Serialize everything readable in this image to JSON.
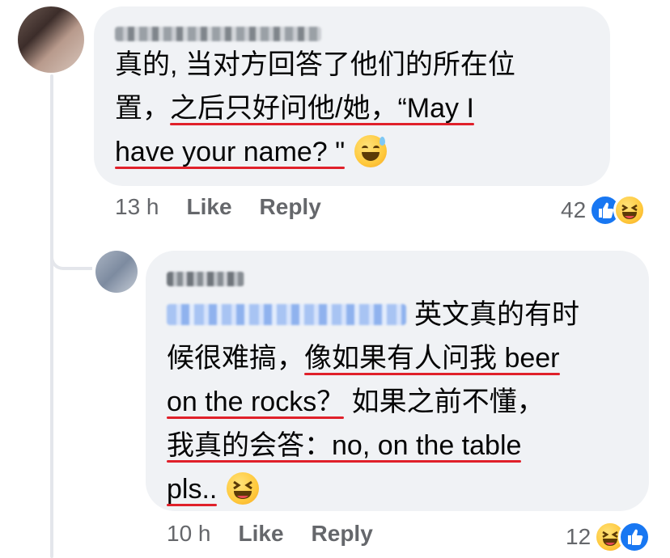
{
  "comment1": {
    "text_lines": [
      "真的, 当对方回答了他们的所在位",
      "置，",
      "之后只好问他/她，“May I",
      "have your name? \""
    ],
    "timestamp": "13 h",
    "like_label": "Like",
    "reply_label": "Reply",
    "reaction_count": "42",
    "reactions": [
      "like-icon",
      "haha-icon"
    ],
    "emoji": "grinning-sweat-emoji"
  },
  "comment2": {
    "text_lines": [
      "英文真的有时",
      "候很难搞，",
      "像如果有人问我 beer",
      "on the rocks？",
      " 如果之前不懂，",
      "我真的会答：no, on the table",
      "pls.."
    ],
    "timestamp": "10 h",
    "like_label": "Like",
    "reply_label": "Reply",
    "reaction_count": "12",
    "reactions": [
      "haha-icon",
      "like-icon"
    ],
    "emoji": "laughing-squint-emoji"
  },
  "colors": {
    "bubble": "#f0f2f5",
    "underline": "#e0202a",
    "meta": "#65676b",
    "like_blue": "#1877f2"
  }
}
